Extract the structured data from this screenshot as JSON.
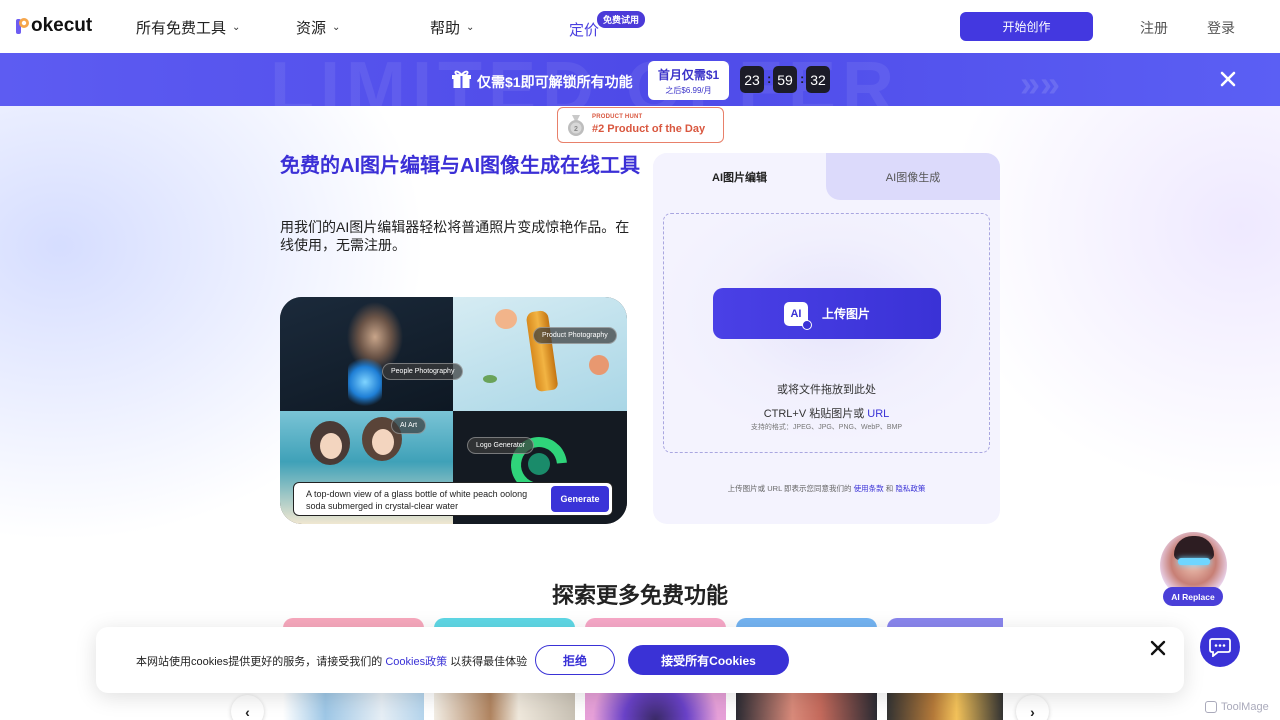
{
  "nav": {
    "logo_text": "okecut",
    "items": [
      {
        "label": "所有免费工具",
        "has_dropdown": true
      },
      {
        "label": "资源",
        "has_dropdown": true
      },
      {
        "label": "帮助",
        "has_dropdown": true
      },
      {
        "label": "定价",
        "has_dropdown": false
      }
    ],
    "trial_badge": "免费试用",
    "cta": "开始创作",
    "register": "注册",
    "login": "登录"
  },
  "promo": {
    "watermark": "LIMITED OFFER",
    "text": "仅需$1即可解锁所有功能",
    "price_main": "首月仅需$1",
    "price_sub": "之后$6.99/月",
    "timer": {
      "hours": "23",
      "minutes": "59",
      "seconds": "32"
    }
  },
  "product_hunt": {
    "small": "PRODUCT HUNT",
    "big": "#2 Product of the Day"
  },
  "hero": {
    "title": "免费的AI图片编辑与AI图像生成在线工具",
    "subtitle": "用我们的AI图片编辑器轻松将普通照片变成惊艳作品。在线使用，无需注册。",
    "collage_tags": {
      "people": "People Photography",
      "product": "Product Photography",
      "ai_art": "AI Art",
      "logo": "Logo Generator"
    },
    "prompt": "A top-down view of a glass bottle of white peach oolong soda submerged in crystal-clear water",
    "generate_label": "Generate"
  },
  "panel": {
    "tabs": [
      {
        "label": "AI图片编辑",
        "active": true
      },
      {
        "label": "AI图像生成",
        "active": false
      }
    ],
    "upload_icon_text": "AI",
    "upload_label": "上传图片",
    "drop_hint": "或将文件拖放到此处",
    "paste_hint": "CTRL+V 粘贴图片或",
    "url_label": "URL",
    "formats": "支持的格式：JPEG、JPG、PNG、WebP、BMP",
    "terms_prefix": "上传图片或 URL 即表示您同意我们的",
    "terms_link": "使用条款",
    "terms_and": "和",
    "privacy_link": "隐私政策"
  },
  "ai_replace": "AI Replace",
  "explore": {
    "title": "探索更多免费功能"
  },
  "cookie": {
    "text_prefix": "本网站使用cookies提供更好的服务，请接受我们的",
    "policy_link": "Cookies政策",
    "text_suffix": "以获得最佳体验",
    "reject": "拒绝",
    "accept": "接受所有Cookies"
  },
  "watermark_brand": "ToolMage",
  "colors": {
    "brand": "#4338e0",
    "promo_bg": "#5554ee",
    "product_hunt": "#d9573f"
  }
}
